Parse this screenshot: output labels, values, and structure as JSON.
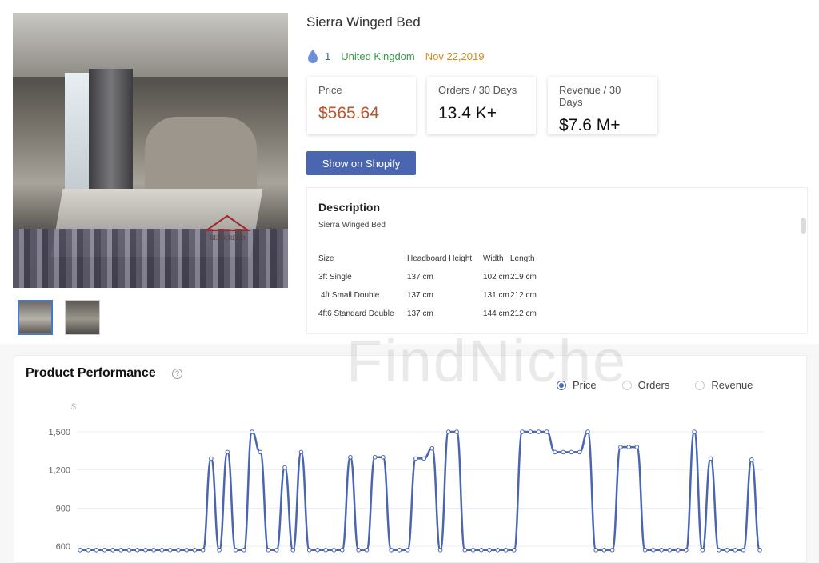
{
  "product": {
    "title": "Sierra Winged Bed",
    "count": "1",
    "country": "United Kingdom",
    "date": "Nov 22,2019",
    "brand_on_image": "BED CREED"
  },
  "stats": {
    "price_label": "Price",
    "price_value": "$565.64",
    "orders_label": "Orders / 30 Days",
    "orders_value": "13.4 K+",
    "revenue_label": "Revenue / 30 Days",
    "revenue_value": "$7.6 M+"
  },
  "shopify_button": "Show on Shopify",
  "description": {
    "title": "Description",
    "subtitle": "Sierra Winged Bed",
    "rows": [
      [
        "Size",
        "Headboard Height",
        "Width",
        "Length"
      ],
      [
        "3ft Single",
        "137 cm",
        "102 cm",
        "219 cm"
      ],
      [
        "4ft Small Double",
        "137 cm",
        "131 cm",
        "212 cm"
      ],
      [
        "4ft6 Standard Double",
        "137 cm",
        "144 cm",
        "212 cm"
      ]
    ]
  },
  "watermark": "FindNiche",
  "performance": {
    "title": "Product Performance",
    "help": "?",
    "options": [
      "Price",
      "Orders",
      "Revenue"
    ],
    "selected": "Price"
  },
  "colors": {
    "accent": "#4a66b0",
    "price": "#b8572c",
    "country": "#3a9a4a",
    "date": "#d28a16"
  },
  "chart_data": {
    "type": "line",
    "ylabel": "$",
    "yticks": [
      600,
      900,
      1200,
      1500
    ],
    "ylim": [
      600,
      1550
    ],
    "grid": true,
    "series": [
      {
        "name": "Price",
        "values": [
          570,
          570,
          570,
          570,
          570,
          570,
          570,
          570,
          570,
          570,
          570,
          570,
          570,
          570,
          570,
          570,
          1290,
          570,
          1340,
          570,
          570,
          1500,
          1340,
          570,
          570,
          1220,
          570,
          1340,
          570,
          570,
          570,
          570,
          570,
          1300,
          570,
          570,
          1300,
          1300,
          570,
          570,
          570,
          1290,
          1290,
          1370,
          570,
          1500,
          1500,
          570,
          570,
          570,
          570,
          570,
          570,
          570,
          1500,
          1500,
          1500,
          1500,
          1340,
          1340,
          1340,
          1340,
          1500,
          570,
          570,
          570,
          1380,
          1380,
          1380,
          570,
          570,
          570,
          570,
          570,
          570,
          1500,
          570,
          1290,
          570,
          570,
          570,
          570,
          1280,
          570
        ]
      }
    ]
  }
}
